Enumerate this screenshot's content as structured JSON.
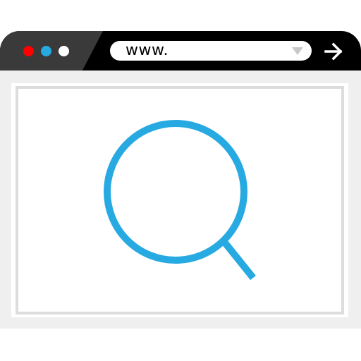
{
  "window": {
    "controls": [
      {
        "name": "close",
        "color": "#ff0000"
      },
      {
        "name": "minimize",
        "color": "#27a9e1"
      },
      {
        "name": "maximize",
        "color": "#ffffff"
      }
    ]
  },
  "address_bar": {
    "value": "www.",
    "dropdown_icon": "triangle-down-icon"
  },
  "toolbar": {
    "go_icon": "arrow-right-icon"
  },
  "content": {
    "icon": "magnifying-glass-icon",
    "icon_color": "#27a9e1"
  }
}
